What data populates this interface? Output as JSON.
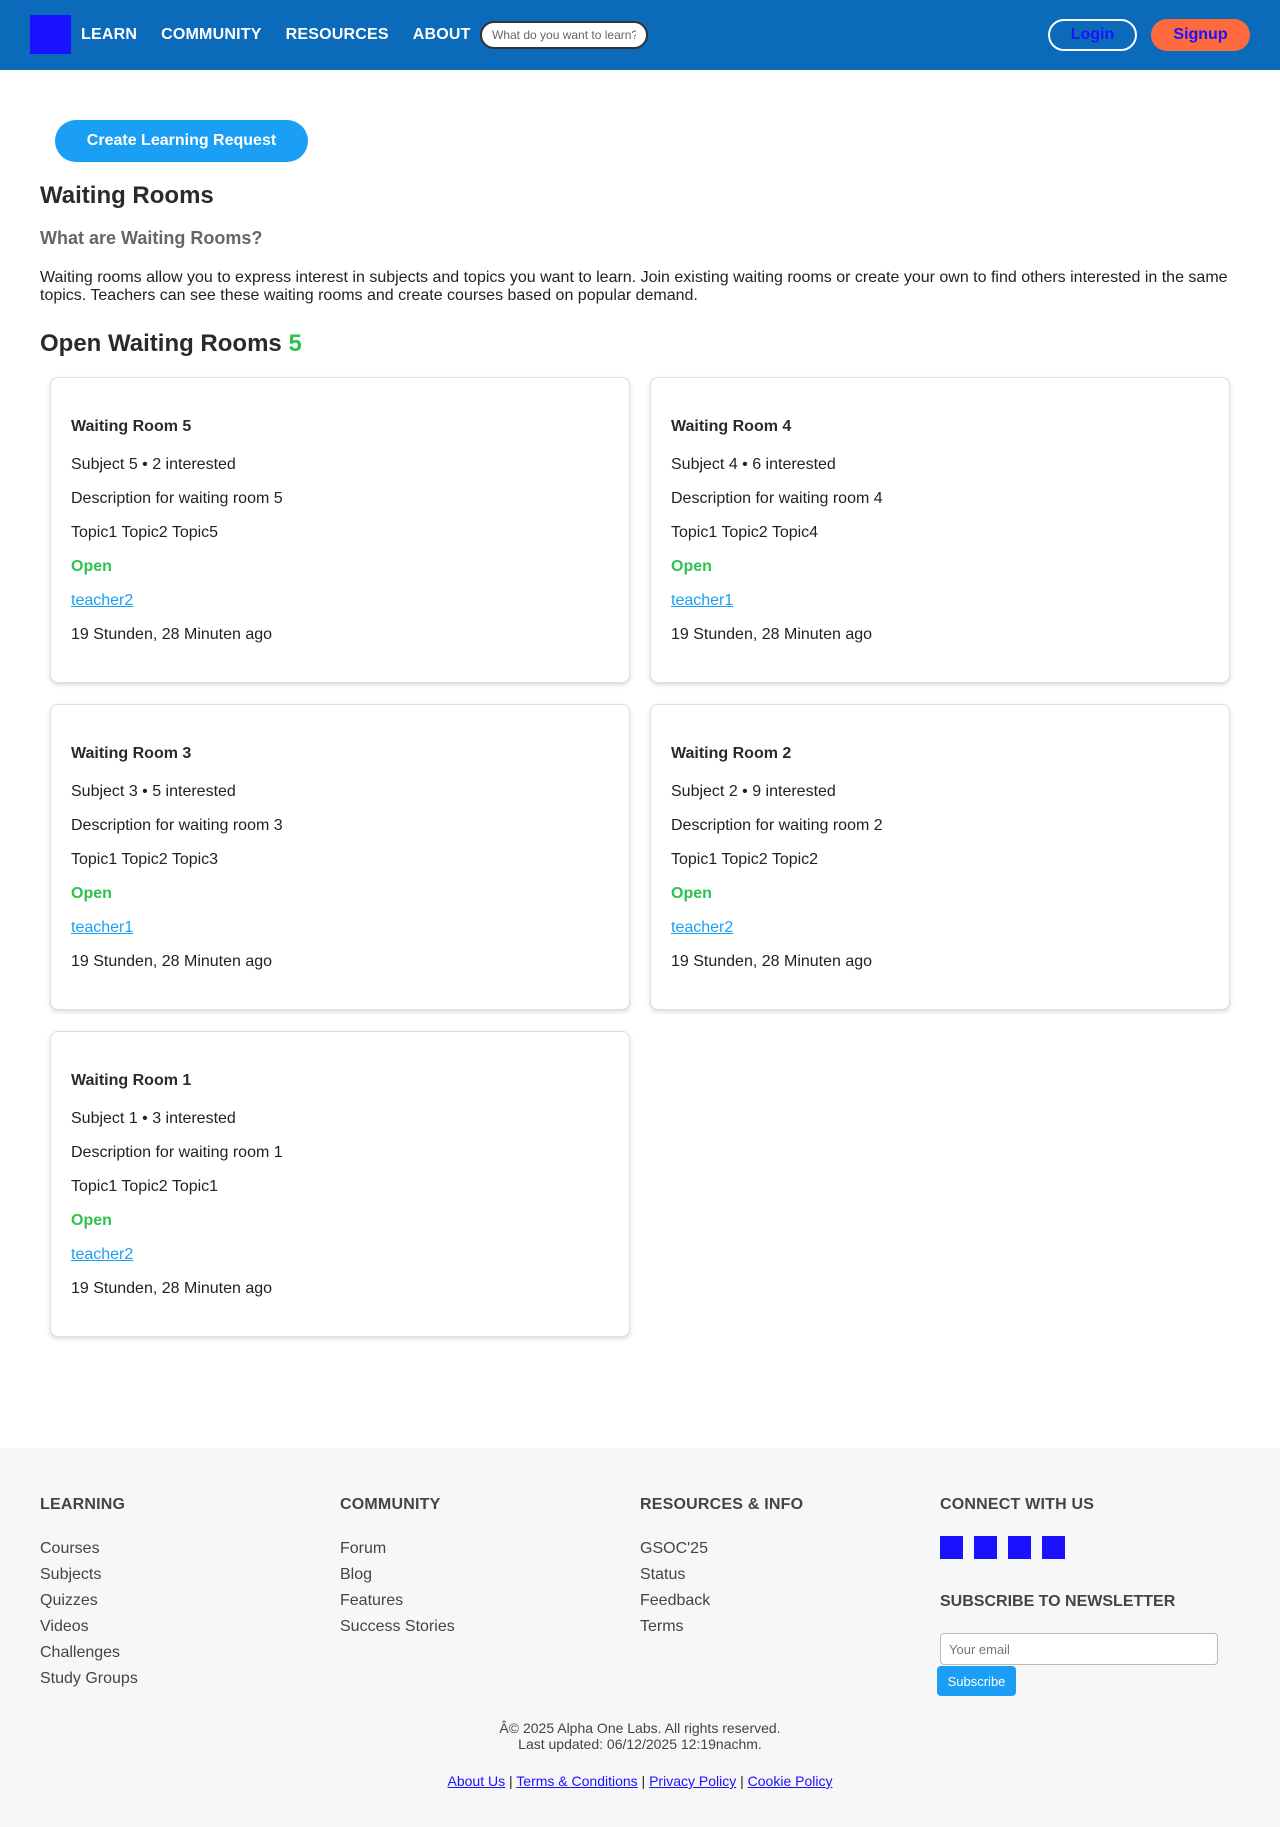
{
  "header": {
    "nav": [
      "LEARN",
      "COMMUNITY",
      "RESOURCES",
      "ABOUT"
    ],
    "search_placeholder": "What do you want to learn?",
    "login_label": "Login",
    "signup_label": "Signup"
  },
  "main": {
    "create_button": "Create Learning Request",
    "title": "Waiting Rooms",
    "subtitle": "What are Waiting Rooms?",
    "intro": "Waiting rooms allow you to express interest in subjects and topics you want to learn. Join existing waiting rooms or create your own to find others interested in the same topics. Teachers can see these waiting rooms and create courses based on popular demand.",
    "open_heading": "Open Waiting Rooms",
    "open_count": "5",
    "rooms": [
      {
        "title": "Waiting Room 5",
        "meta": "Subject 5 • 2 interested",
        "description": "Description for waiting room 5",
        "topics": "Topic1 Topic2 Topic5",
        "status": "Open",
        "teacher": "teacher2",
        "time": "19 Stunden, 28 Minuten ago"
      },
      {
        "title": "Waiting Room 4",
        "meta": "Subject 4 • 6 interested",
        "description": "Description for waiting room 4",
        "topics": "Topic1 Topic2 Topic4",
        "status": "Open",
        "teacher": "teacher1",
        "time": "19 Stunden, 28 Minuten ago"
      },
      {
        "title": "Waiting Room 3",
        "meta": "Subject 3 • 5 interested",
        "description": "Description for waiting room 3",
        "topics": "Topic1 Topic2 Topic3",
        "status": "Open",
        "teacher": "teacher1",
        "time": "19 Stunden, 28 Minuten ago"
      },
      {
        "title": "Waiting Room 2",
        "meta": "Subject 2 • 9 interested",
        "description": "Description for waiting room 2",
        "topics": "Topic1 Topic2 Topic2",
        "status": "Open",
        "teacher": "teacher2",
        "time": "19 Stunden, 28 Minuten ago"
      },
      {
        "title": "Waiting Room 1",
        "meta": "Subject 1 • 3 interested",
        "description": "Description for waiting room 1",
        "topics": "Topic1 Topic2 Topic1",
        "status": "Open",
        "teacher": "teacher2",
        "time": "19 Stunden, 28 Minuten ago"
      }
    ]
  },
  "footer": {
    "learning": {
      "title": "LEARNING",
      "links": [
        "Courses",
        "Subjects",
        "Quizzes",
        "Videos",
        "Challenges",
        "Study Groups"
      ]
    },
    "community": {
      "title": "COMMUNITY",
      "links": [
        "Forum",
        "Blog",
        "Features",
        "Success Stories"
      ]
    },
    "resources": {
      "title": "RESOURCES & INFO",
      "links": [
        "GSOC'25",
        "Status",
        "Feedback",
        "Terms"
      ]
    },
    "connect": {
      "title": "CONNECT WITH US",
      "social_icons": [
        "social-icon-1",
        "social-icon-2",
        "social-icon-3",
        "social-icon-4"
      ]
    },
    "newsletter": {
      "title": "SUBSCRIBE TO NEWSLETTER",
      "placeholder": "Your email",
      "button": "Subscribe"
    },
    "copyright": "Â© 2025 Alpha One Labs. All rights reserved.",
    "last_updated": "Last updated: 06/12/2025 12:19nachm.",
    "legal_links": [
      "About Us",
      "Terms & Conditions",
      "Privacy Policy",
      "Cookie Policy"
    ]
  },
  "colors": {
    "header_bg": "#0c6abb",
    "accent_blue": "#1b9ff5",
    "signup_orange": "#ff6a3d",
    "status_green": "#2bc24f",
    "logo_blue": "#1a12ff"
  }
}
